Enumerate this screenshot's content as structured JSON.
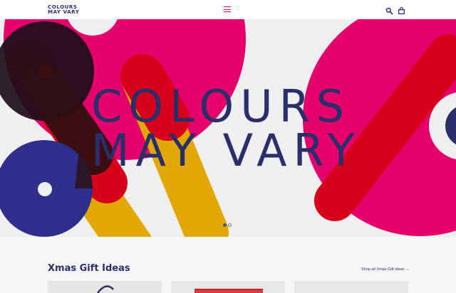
{
  "header": {
    "logo_line1": "COLOURS",
    "logo_line2": "MAY VARY",
    "menu_icon": "hamburger-menu-icon",
    "search_icon": "search-icon",
    "bag_icon": "shopping-bag-icon"
  },
  "hero": {
    "title_line1": "COLOURS",
    "title_line2": "MAY VARY",
    "slides_total": 2,
    "active_slide": 1
  },
  "gifts": {
    "title": "Xmas Gift Ideas",
    "shop_link": "Shop all Xmas Gift Ideas →"
  },
  "colors": {
    "navy": "#2a2f6b",
    "pink": "#e6006b",
    "red": "#d6001c",
    "yellow": "#e0a800",
    "dark": "#1c0e1a",
    "background": "#efefef"
  }
}
